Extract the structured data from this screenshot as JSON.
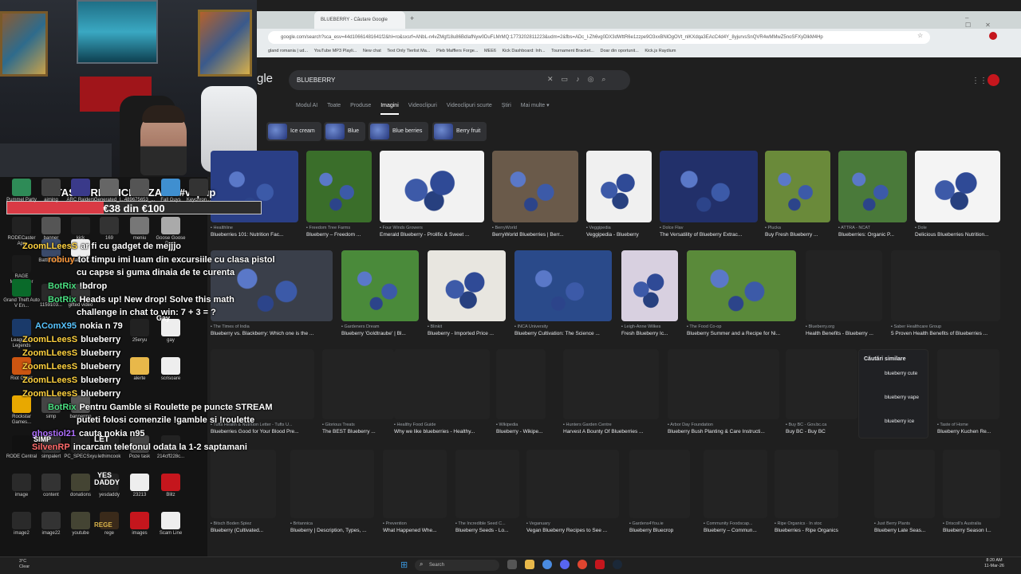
{
  "browser": {
    "tab_title": "BLUEBERRY - Căutare Google",
    "url": "google.com/search?sca_esv=44d10661481641f2&hl=ro&sxsrf=ANbL-n4vZMgf18u86BdIafNyw0DuFLMrMQ:1773202811223&udm=2&fbs=ADc_l-Zh6vg0DX3dWttR6e1zzpe9O3xxBNlOgOVt_nlKXdqa3EAcC4d4Y_8yjurvsSnQVR4wMMwZ5noSFXyDlkM4Hp",
    "bookmarks": [
      "gland romania | ud...",
      "",
      "YouTube MP3 Playli...",
      "New chat",
      "Text Only Tierlist Ma...",
      "Pleb Mafflers Forge...",
      "MEE6",
      "Kick Dashboard: Inh...",
      "Tournament Bracket...",
      "Doar din oportunit...",
      "Kick.js Raydium"
    ]
  },
  "google": {
    "logo": "gle",
    "query": "BLUEBERRY",
    "nav": [
      "Modul AI",
      "Toate",
      "Produse",
      "Imagini",
      "Videoclipuri",
      "Videoclipuri scurte",
      "Știri",
      "Mai multe ▾"
    ],
    "chips": [
      "Ice cream",
      "Blue",
      "Blue berries",
      "Berry fruit"
    ],
    "row1": [
      {
        "src": "Healthline",
        "cap": "Blueberries 101: Nutrition Fac..."
      },
      {
        "src": "Freedom Tree Farms",
        "cap": "Blueberry – Freedom ..."
      },
      {
        "src": "Four Winds Growers",
        "cap": "Emerald Blueberry - Prolific & Sweet ..."
      },
      {
        "src": "BerryWorld",
        "cap": "BerryWorld Blueberries | Berr..."
      },
      {
        "src": "Veggipedia",
        "cap": "Veggipedia - Blueberry"
      },
      {
        "src": "Dolce Flav",
        "cap": "The Versatility of Blueberry Extrac..."
      },
      {
        "src": "Plucka",
        "cap": "Buy Fresh Blueberry ..."
      },
      {
        "src": "ATTRA - NCAT",
        "cap": "Blueberries: Organic P..."
      },
      {
        "src": "Dole",
        "cap": "Delicious Blueberries Nutrition..."
      }
    ],
    "row2": [
      {
        "src": "The Times of India",
        "cap": "Blueberry vs. Blackberry: Which one is the ..."
      },
      {
        "src": "Gardeners Dream",
        "cap": "Blueberry 'Goldtraube' | Bl..."
      },
      {
        "src": "Blinkit",
        "cap": "Blueberry - Imported Price ..."
      },
      {
        "src": "INCA University",
        "cap": "Blueberry Cultivation: The Science ..."
      },
      {
        "src": "Leigh-Anne Wilkes",
        "cap": "Fresh Blueberry Ic..."
      },
      {
        "src": "The Food Co-op",
        "cap": "Blueberry Summer and a Recipe for Ni..."
      },
      {
        "src": "Blueberry.org",
        "cap": "Health Benefits - Blueberry ..."
      },
      {
        "src": "Saber Healthcare Group",
        "cap": "5 Proven Health Benefits of Blueberries ..."
      }
    ],
    "row3": [
      {
        "src": "Tufts Health & Nutrition Letter - Tufts U...",
        "cap": "Blueberries Good for Your Blood Pre..."
      },
      {
        "src": "Glorious Treats",
        "cap": "The BEST Blueberry ..."
      },
      {
        "src": "Healthy Food Guide",
        "cap": "Why we like blueberries - Healthy..."
      },
      {
        "src": "Wikipedia",
        "cap": "Blueberry - Wikipe..."
      },
      {
        "src": "Hunters Garden Centre",
        "cap": "Harvest A Bounty Of Blueberries ..."
      },
      {
        "src": "Arbor Day Foundation",
        "cap": "Blueberry Bush Planting & Care Instructi..."
      },
      {
        "src": "Buy BC - Gov.bc.ca",
        "cap": "Buy BC - Buy BC"
      },
      {
        "src": "Taste of Home",
        "cap": "Blueberry Kuchen Re..."
      }
    ],
    "row4": [
      {
        "src": "Bitsch Boden Spiez",
        "cap": "Blueberry (Cultivated..."
      },
      {
        "src": "Britannica",
        "cap": "Blueberry | Description, Types, ..."
      },
      {
        "src": "Prevention",
        "cap": "What Happened Whe..."
      },
      {
        "src": "The Incredible Seed C...",
        "cap": "Blueberry Seeds - Lo..."
      },
      {
        "src": "Veganuary",
        "cap": "Vegan Blueberry Recipes to See ..."
      },
      {
        "src": "Gardens4You.ie",
        "cap": "Blueberry Bluecrop"
      },
      {
        "src": "Community Foodscap...",
        "cap": "Blueberry – Commun..."
      },
      {
        "src": "Ripe Organics · În stoc",
        "cap": "Blueberries - Ripe Organics"
      },
      {
        "src": "Just Berry Plants",
        "cap": "Blueberry Late Seas..."
      },
      {
        "src": "Driscoll's Australia",
        "cap": "Blueberry Season I..."
      }
    ],
    "related_title": "Căutări similare",
    "related": [
      "blueberry cute",
      "blueberry vape",
      "blueberry ice"
    ]
  },
  "overlay": {
    "title": "TASKURI OFICIALIZARE #vapup",
    "progress_text": "€38 din €100",
    "progress_fraction": 0.38,
    "gay_label": "Gay"
  },
  "desktop_icons": [
    {
      "label": "Pummel Party"
    },
    {
      "label": "aiming"
    },
    {
      "label": "ARC Raiders"
    },
    {
      "label": "Generated_I..."
    },
    {
      "label": "489675653_..."
    },
    {
      "label": "Fall Guys"
    },
    {
      "label": "Keychron..."
    },
    {
      "label": "RODECaster App"
    },
    {
      "label": "banner"
    },
    {
      "label": "kick"
    },
    {
      "label": "169"
    },
    {
      "label": "meniu"
    },
    {
      "label": "Goose Goose Duck"
    },
    {
      "label": "RAGE Multiplayer"
    },
    {
      "label": "Battlefield 6"
    },
    {
      "label": "colaborar..."
    },
    {
      "label": "Grand Theft Auto V En..."
    },
    {
      "label": "1159103..."
    },
    {
      "label": "gifted video"
    },
    {
      "label": "League of Legends"
    },
    {
      "label": "25eryu"
    },
    {
      "label": "gay"
    },
    {
      "label": "Riot Client"
    },
    {
      "label": "alerte"
    },
    {
      "label": "scrisoare"
    },
    {
      "label": "Rockstar Games..."
    },
    {
      "label": "simp"
    },
    {
      "label": "bannermp"
    },
    {
      "label": "RODE Central"
    },
    {
      "label": "simpalert"
    },
    {
      "label": "PC_SPECSxyu"
    },
    {
      "label": "lethimcook"
    },
    {
      "label": "Poze task"
    },
    {
      "label": "214cff228c..."
    },
    {
      "label": "image"
    },
    {
      "label": "content"
    },
    {
      "label": "donations"
    },
    {
      "label": "yesdaddy"
    },
    {
      "label": "23213"
    },
    {
      "label": "Blitz"
    },
    {
      "label": "image2"
    },
    {
      "label": "image22"
    },
    {
      "label": "youtube"
    },
    {
      "label": "rege"
    },
    {
      "label": "images"
    },
    {
      "label": "Scam Line"
    }
  ],
  "desktop_text": {
    "yes_daddy": "YES DADDY",
    "rege": "REGE",
    "simp": "SIMP",
    "let": "LET"
  },
  "chat": [
    {
      "user": "ZoomLLeesS",
      "msg": "ar fi cu gadget de mejjjo"
    },
    {
      "user": "robiuy",
      "msg": "tot timpu imi luam din excursiile cu clasa pistol"
    },
    {
      "user": "",
      "msg": "cu capse si guma dinaia de te curenta"
    },
    {
      "user": "BotRix",
      "msg": "!bdrop"
    },
    {
      "user": "BotRix",
      "msg": "Heads up! New drop!   Solve this math"
    },
    {
      "user": "",
      "msg": "challenge in chat to win: 7 + 3 = ?"
    },
    {
      "user": "AComX95",
      "msg": "nokia n 79"
    },
    {
      "user": "ZoomLLeesS",
      "msg": "blueberry"
    },
    {
      "user": "ZoomLLeesS",
      "msg": "blueberry"
    },
    {
      "user": "ZoomLLeesS",
      "msg": "blueberry"
    },
    {
      "user": "ZoomLLeesS",
      "msg": "blueberry"
    },
    {
      "user": "ZoomLLeesS",
      "msg": "blueberry"
    },
    {
      "user": "BotRix",
      "msg": "Pentru Gamble si Roulette pe puncte STREAM"
    },
    {
      "user": "",
      "msg": "puteti folosi comenzile !gamble si !roulette"
    },
    {
      "user": "ghostiol21",
      "msg": "cauta nokia n95"
    },
    {
      "user": "SilvenRP",
      "msg": "incarcam telefonul odata la 1-2 saptamani"
    }
  ],
  "taskbar": {
    "search": "Search",
    "weather": "3°C",
    "weather_sub": "Clear",
    "time": "8:20 AM",
    "date": "11-Mar-26"
  },
  "colors": {
    "progress": "#d93a45",
    "avatar": "#c5161d",
    "chip_bg": "#303134"
  }
}
